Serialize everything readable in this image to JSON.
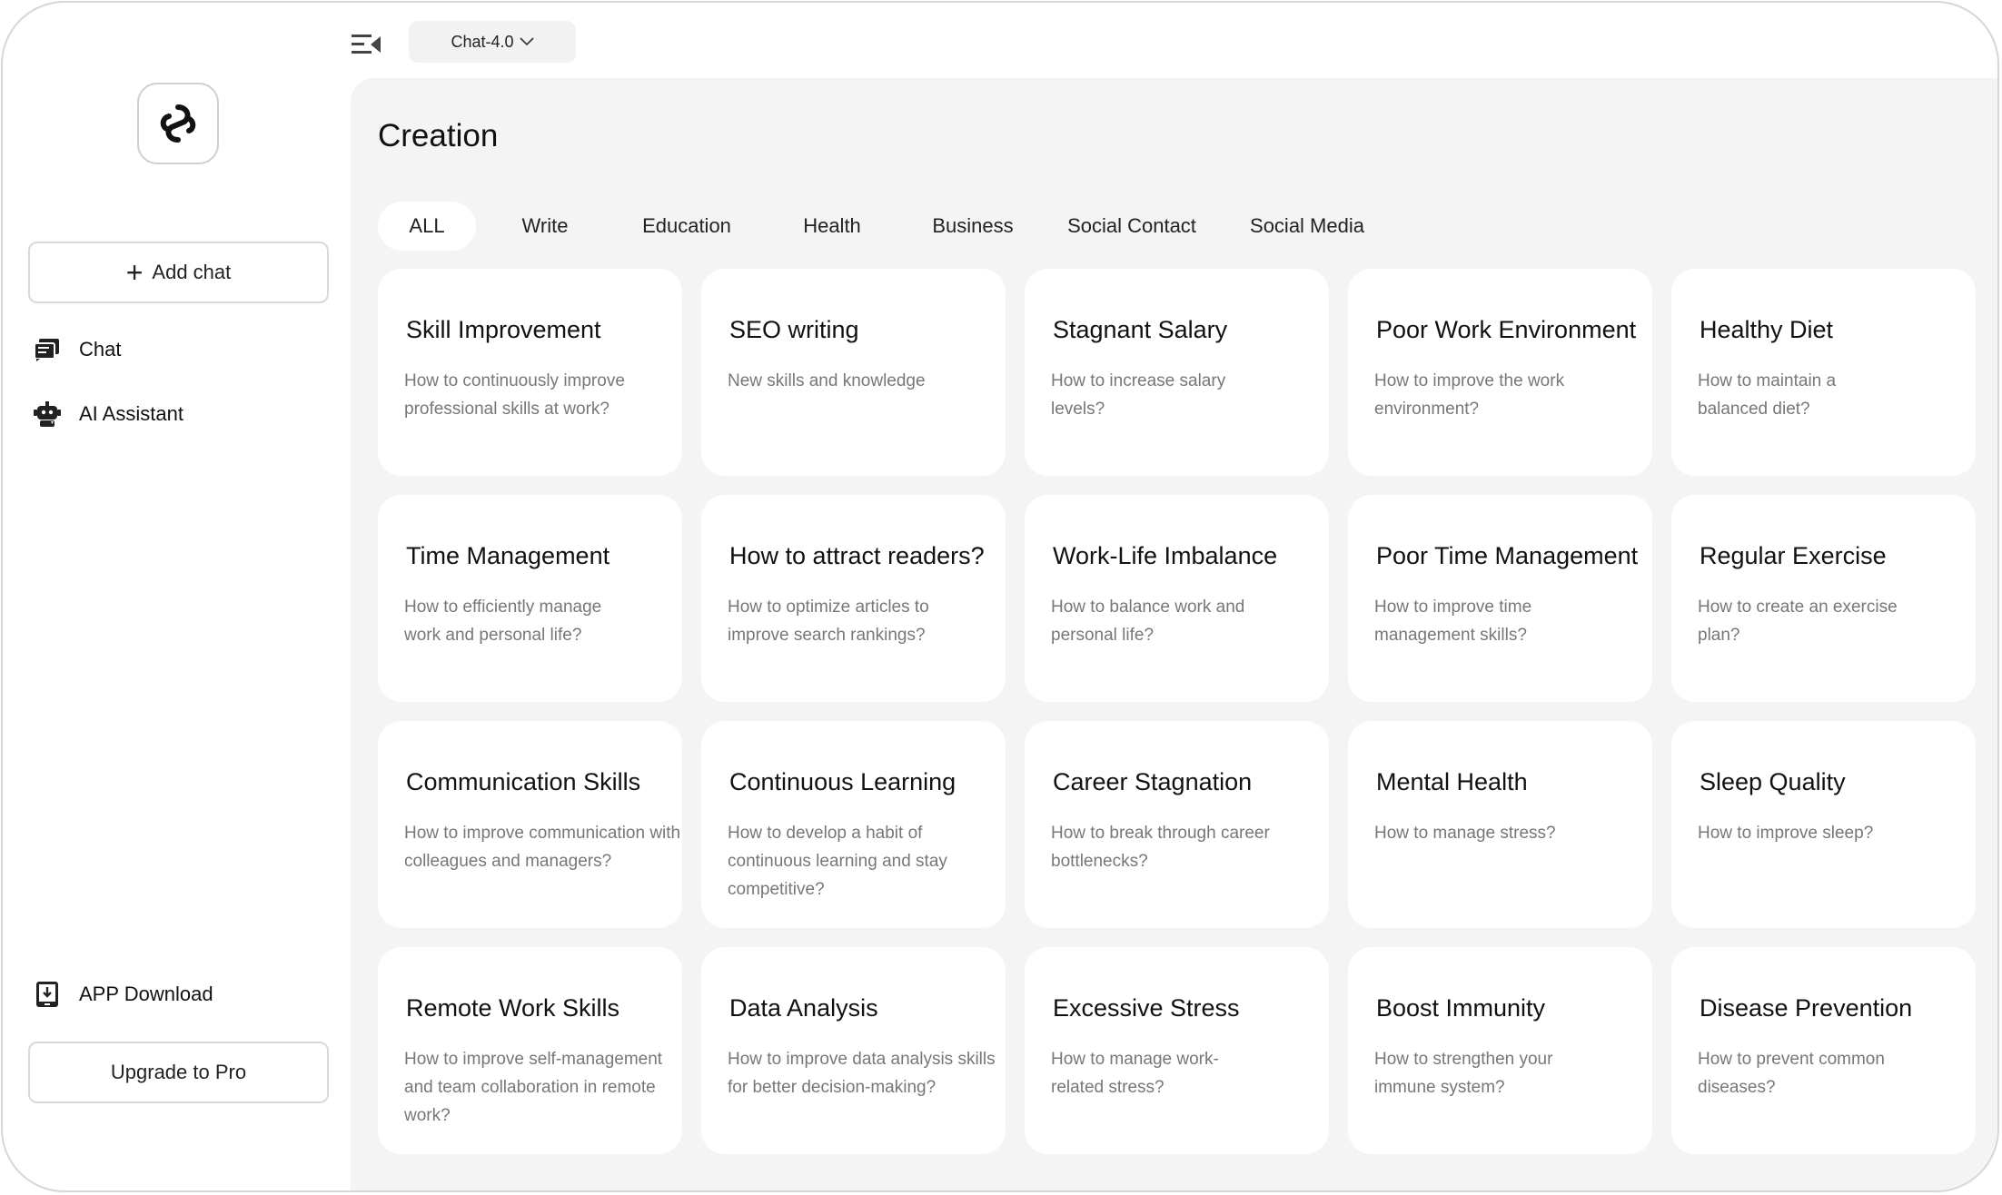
{
  "sidebar": {
    "add_chat_label": "Add chat",
    "nav": [
      {
        "label": "Chat",
        "icon": "chat-icon"
      },
      {
        "label": "AI Assistant",
        "icon": "robot-icon"
      }
    ],
    "app_download_label": "APP Download",
    "upgrade_label": "Upgrade to Pro"
  },
  "header": {
    "model_label": "Chat-4.0"
  },
  "main": {
    "title": "Creation",
    "tabs": [
      {
        "label": "ALL",
        "active": true
      },
      {
        "label": "Write"
      },
      {
        "label": "Education"
      },
      {
        "label": "Health"
      },
      {
        "label": "Business"
      },
      {
        "label": "Social Contact"
      },
      {
        "label": "Social Media"
      }
    ],
    "cards": [
      {
        "title": "Skill Improvement",
        "desc": "How to continuously improve professional skills at work?"
      },
      {
        "title": "SEO writing",
        "desc": "New skills and knowledge"
      },
      {
        "title": "Stagnant Salary",
        "desc": "How to increase salary levels?"
      },
      {
        "title": "Poor Work Environment",
        "desc": "How to improve the work environment?"
      },
      {
        "title": "Healthy Diet",
        "desc": "How to maintain a balanced diet?"
      },
      {
        "title": "Time Management",
        "desc": "How to efficiently manage work and personal life?"
      },
      {
        "title": "How to attract readers?",
        "desc": "How to optimize articles to improve search rankings?"
      },
      {
        "title": "Work-Life Imbalance",
        "desc": "How to balance work and personal life?"
      },
      {
        "title": "Poor Time Management",
        "desc": "How to improve time management skills?"
      },
      {
        "title": "Regular Exercise",
        "desc": "How to create an exercise plan?"
      },
      {
        "title": "Communication Skills",
        "desc": "How to improve communication with colleagues and managers?"
      },
      {
        "title": "Continuous Learning",
        "desc": "How to develop a habit of continuous learning and stay competitive?"
      },
      {
        "title": "Career Stagnation",
        "desc": "How to break through career bottlenecks?"
      },
      {
        "title": "Mental Health",
        "desc": "How to manage stress?"
      },
      {
        "title": "Sleep Quality",
        "desc": "How to improve sleep?"
      },
      {
        "title": "Remote Work Skills",
        "desc": "How to improve self-management and team collaboration in remote work?"
      },
      {
        "title": "Data Analysis",
        "desc": "How to improve data analysis skills for better decision-making?"
      },
      {
        "title": "Excessive Stress",
        "desc": "How to manage work-related stress?"
      },
      {
        "title": "Boost Immunity",
        "desc": "How to strengthen your immune system?"
      },
      {
        "title": "Disease Prevention",
        "desc": "How to prevent common diseases?"
      }
    ]
  }
}
